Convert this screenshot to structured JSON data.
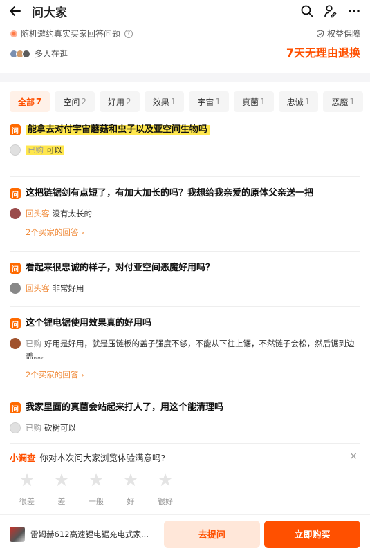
{
  "header": {
    "title": "问大家"
  },
  "intro": {
    "invite_text": "随机邀约真实买家回答问题",
    "browsing_text": "多人在逛",
    "guarantee_label": "权益保障",
    "return_policy": "7天无理由退换"
  },
  "tabs": [
    {
      "label": "全部",
      "count": "7"
    },
    {
      "label": "空间",
      "count": "2"
    },
    {
      "label": "好用",
      "count": "2"
    },
    {
      "label": "效果",
      "count": "1"
    },
    {
      "label": "宇宙",
      "count": "1"
    },
    {
      "label": "真菌",
      "count": "1"
    },
    {
      "label": "忠诚",
      "count": "1"
    },
    {
      "label": "恶魔",
      "count": "1"
    }
  ],
  "qa": [
    {
      "badge": "问",
      "question": "能拿去对付宇宙蘑菇和虫子以及亚空间生物吗",
      "tag": "已购",
      "answer": "可以",
      "more": ""
    },
    {
      "badge": "问",
      "question": "这把链锯剑有点短了，有加大加长的吗？我想给我亲爱的原体父亲送一把",
      "tag": "回头客",
      "answer": "没有太长的",
      "more": "2个买家的回答"
    },
    {
      "badge": "问",
      "question": "看起来很忠诚的样子，对付亚空间恶魔好用吗？",
      "tag": "回头客",
      "answer": "非常好用",
      "more": ""
    },
    {
      "badge": "问",
      "question": "这个锂电锯使用效果真的好用吗",
      "tag": "已购",
      "answer": "好用是好用，就是压链板的盖子强度不够，不能从下往上锯，不然链子会松，然后锯到边盖。。。",
      "more": "2个买家的回答"
    },
    {
      "badge": "问",
      "question": "我家里面的真菌会站起来打人了，用这个能清理吗",
      "tag": "已购",
      "answer": "砍树可以",
      "more": ""
    }
  ],
  "survey": {
    "label": "小调查",
    "question": "你对本次问大家浏览体验满意吗?",
    "close": "×",
    "ratings": [
      "很差",
      "差",
      "一般",
      "好",
      "很好"
    ]
  },
  "bottom": {
    "product_title": "雷姆赫612高速锂电锯充电式家...",
    "ask_button": "去提问",
    "buy_button": "立即购买"
  },
  "colors": {
    "accent": "#ff5000",
    "highlight": "#ffe74d",
    "tag": "#f08c3c"
  }
}
